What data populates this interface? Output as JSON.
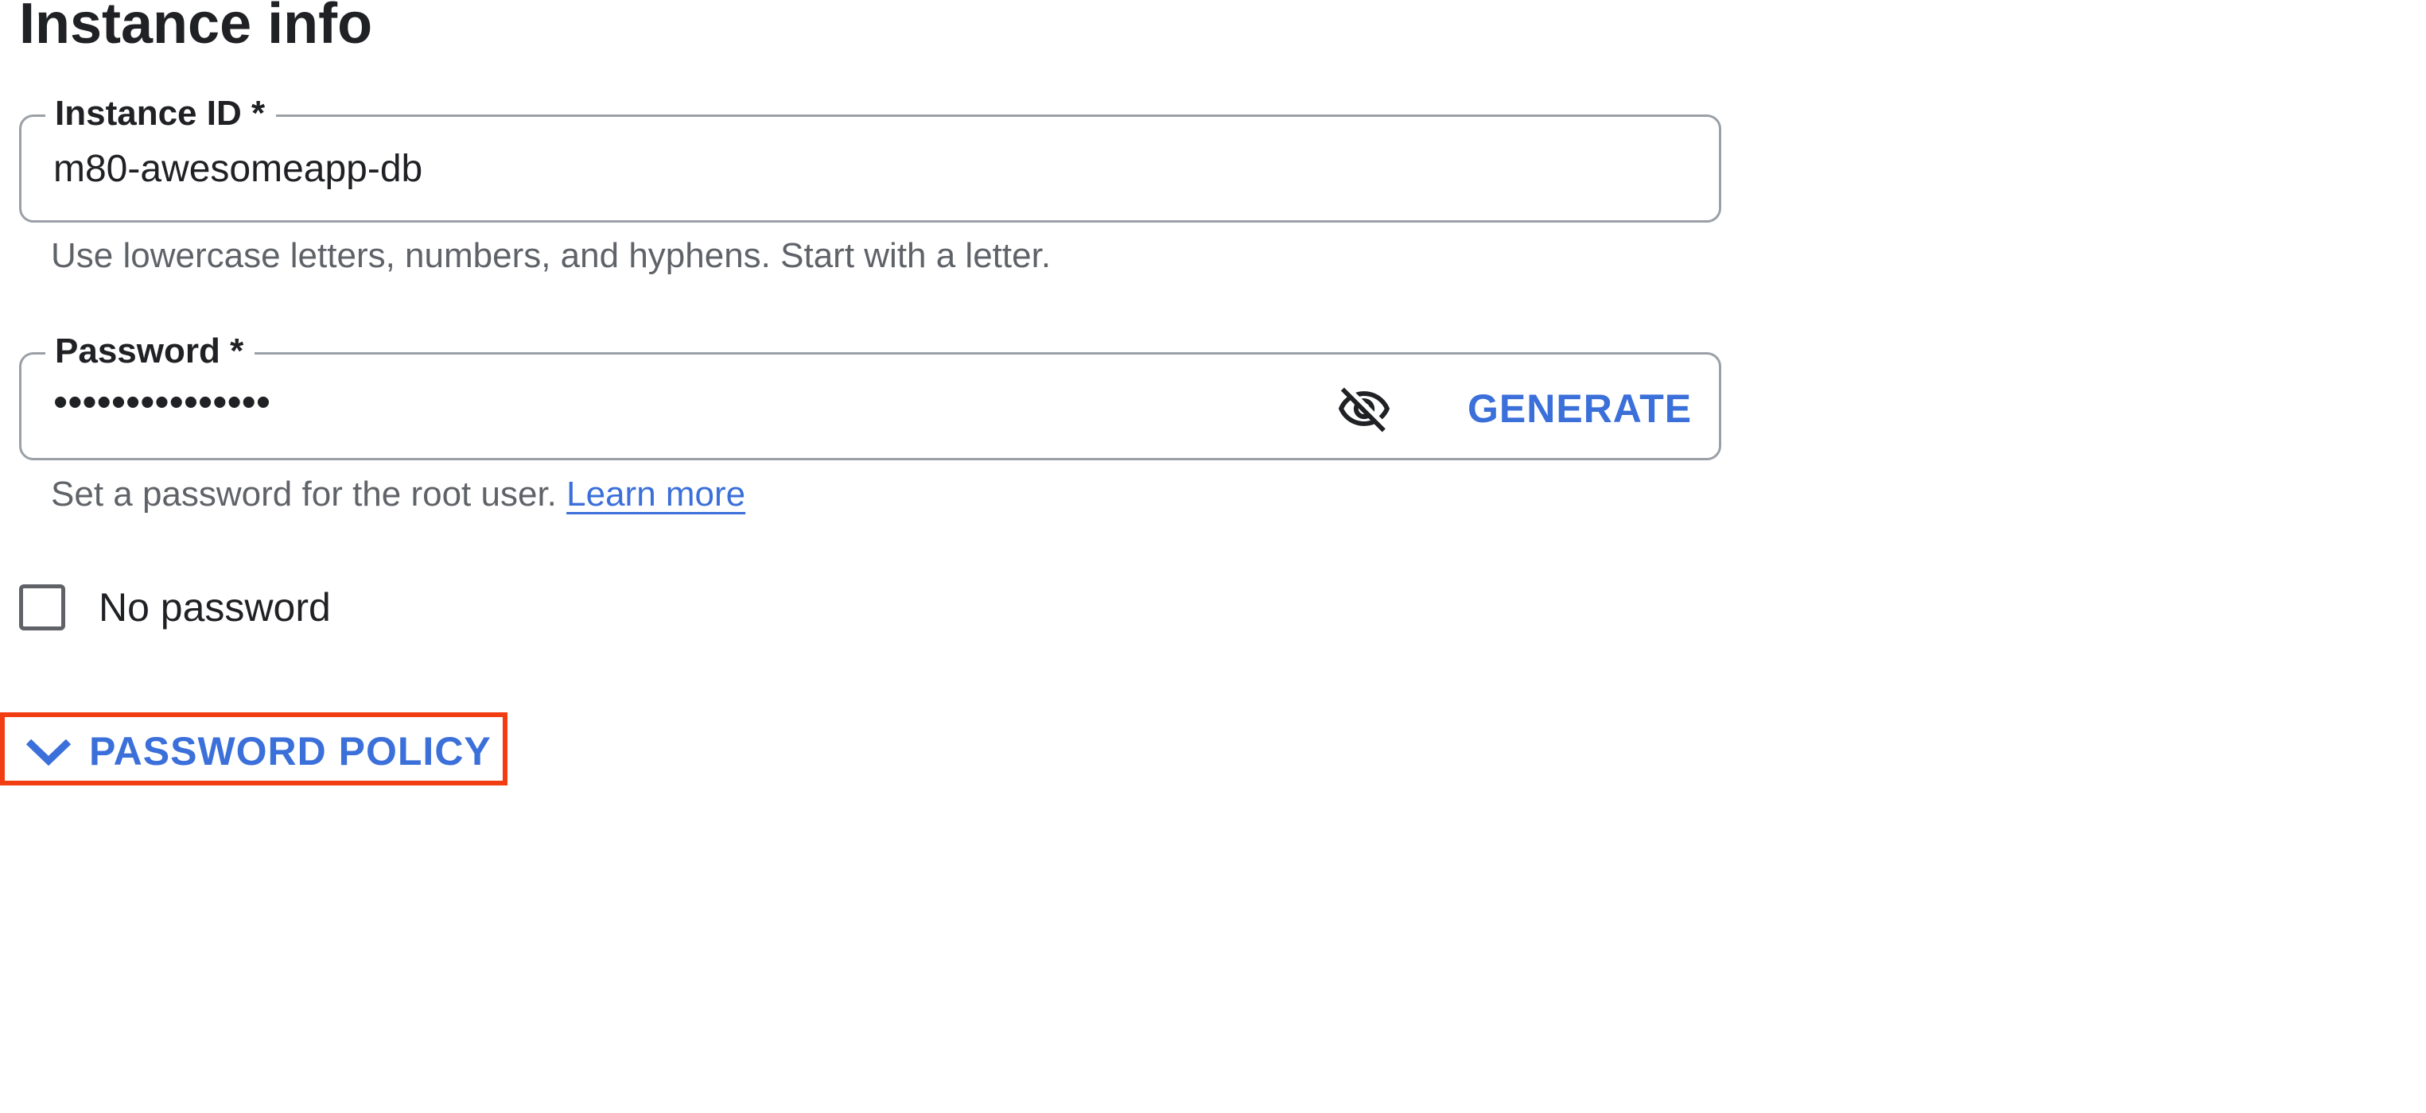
{
  "section": {
    "title": "Instance info"
  },
  "instance_id": {
    "label": "Instance ID *",
    "value": "m80-awesomeapp-db",
    "hint": "Use lowercase letters, numbers, and hyphens. Start with a letter."
  },
  "password": {
    "label": "Password *",
    "masked_value": "•••••••••••••••",
    "visibility_icon": "eye-off-icon",
    "generate_label": "GENERATE",
    "hint": "Set a password for the root user.",
    "learn_more_label": "Learn more"
  },
  "no_password": {
    "label": "No password",
    "checked": false
  },
  "password_policy": {
    "label": "PASSWORD POLICY",
    "icon": "chevron-down-icon",
    "highlighted": true
  },
  "colors": {
    "accent": "#3b6fd9",
    "highlight_border": "#f23d13",
    "border": "#9aa0a6",
    "hint_text": "#5f6368"
  }
}
